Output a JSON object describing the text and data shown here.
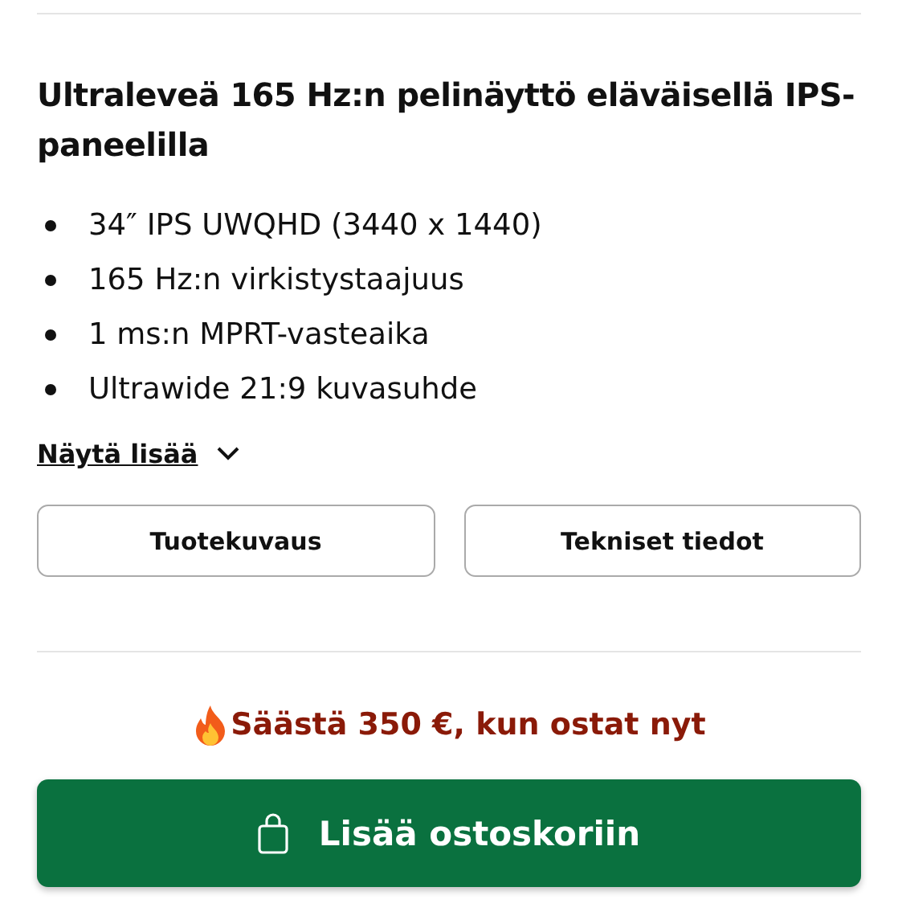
{
  "title": "Ultraleveä 165 Hz:n pelinäyttö eläväisellä IPS-paneelilla",
  "features": [
    "34″ IPS UWQHD (3440 x 1440)",
    "165 Hz:n virkistystaajuus",
    "1 ms:n MPRT-vasteaika",
    "Ultrawide 21:9 kuvasuhde"
  ],
  "show_more": {
    "label": "Näytä lisää",
    "expanded": false
  },
  "tabs": [
    {
      "label": "Tuotekuvaus"
    },
    {
      "label": "Tekniset tiedot"
    }
  ],
  "promo": "Säästä 350 €, kun ostat nyt",
  "add_to_cart": "Lisää ostoskoriin"
}
